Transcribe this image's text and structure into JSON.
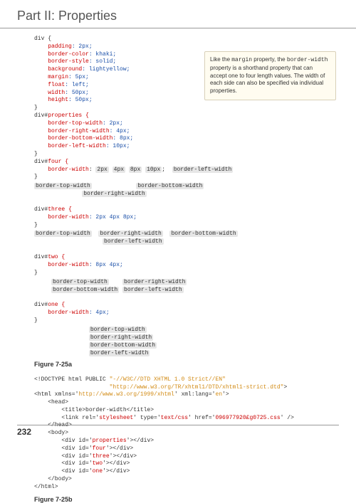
{
  "title": "Part II: Properties",
  "page_number": "232",
  "callout": {
    "part1": "Like the ",
    "code1": "margin",
    "part2": " property, the ",
    "code2": "border-width",
    "part3": " property is a shorthand property that can accept one to four length values. The width of each side can also be specified via individual properties."
  },
  "code": {
    "div_open": "div {",
    "p_padding": "    padding",
    "p_padding_v": ": 2px;",
    "p_bc": "    border-color",
    "p_bc_v": ": khaki;",
    "p_bs": "    border-style",
    "p_bs_v": ": solid;",
    "p_bg": "    background",
    "p_bg_v": ": lightyellow;",
    "p_m": "    margin",
    "p_m_v": ": 5px;",
    "p_f": "    float",
    "p_f_v": ": left;",
    "p_w": "    width",
    "p_w_v": ": 50px;",
    "p_h": "    height",
    "p_h_v": ": 50px;",
    "close": "}",
    "props_open_a": "div#",
    "props_open_b": "properties {",
    "btw": "    border-top-width",
    "btw_v": ": 2px;",
    "brw": "    border-right-width",
    "brw_v": ": 4px;",
    "bbw": "    border-bottom-width",
    "bbw_v": ": 8px;",
    "blw": "    border-left-width",
    "blw_v": ": 10px;",
    "four_open_a": "div#",
    "four_open_b": "four {",
    "four_bw": "    border-width",
    "four_v1": "2px",
    "four_v2": "4px",
    "four_v3": "8px",
    "four_v4": "10px",
    "lbl_btw": "border-top-width",
    "lbl_brw": "border-right-width",
    "lbl_bbw": "border-bottom-width",
    "lbl_blw": "border-left-width",
    "three_open_a": "div#",
    "three_open_b": "three {",
    "three_bw": "    border-width",
    "three_bw_v": ": 2px 4px 8px;",
    "two_open_a": "div#",
    "two_open_b": "two {",
    "two_bw": "    border-width",
    "two_bw_v": ": 8px 4px;",
    "one_open_a": "div#",
    "one_open_b": "one {",
    "one_bw": "    border-width",
    "one_bw_v": ": 4px;"
  },
  "fig_a": "Figure 7-25a",
  "html_listing": {
    "doctype_a": "<!DOCTYPE html PUBLIC ",
    "doctype_b": "\"-//W3C//DTD XHTML 1.0 Strict//EN\"",
    "doctype_c": "                      ",
    "doctype_d": "\"http://www.w3.org/TR/xhtml1/DTD/xhtml1-strict.dtd\"",
    "doctype_e": ">",
    "html_a": "<html xmlns='",
    "html_b": "http://www.w3.org/1999/xhtml",
    "html_c": "' xml:lang='",
    "html_d": "en",
    "html_e": "'>",
    "head": "    <head>",
    "title": "        <title>border-width</title>",
    "link_a": "        <link rel='",
    "link_b": "stylesheet",
    "link_c": "' type='",
    "link_d": "text/css",
    "link_e": "' href='",
    "link_f": "096977920£g0725.css",
    "link_g": "' />",
    "headc": "    </head>",
    "body": "    <body>",
    "d1a": "        <div id='",
    "d1b": "properties",
    "d1c": "'></div>",
    "d2a": "        <div id='",
    "d2b": "four",
    "d2c": "'></div>",
    "d3a": "        <div id='",
    "d3b": "three",
    "d3c": "'></div>",
    "d4a": "        <div id='",
    "d4b": "two",
    "d4c": "'></div>",
    "d5a": "        <div id='",
    "d5b": "one",
    "d5c": "'></div>",
    "bodyc": "    </body>",
    "htmlc": "</html>"
  },
  "fig_b": "Figure 7-25b"
}
